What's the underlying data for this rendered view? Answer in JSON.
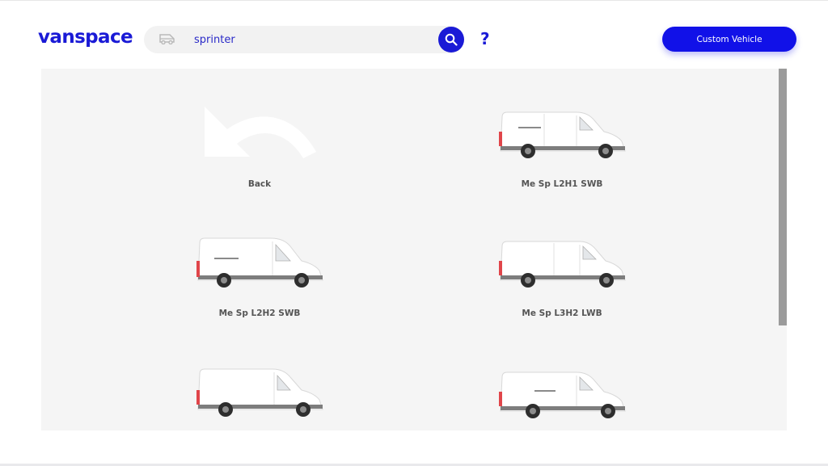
{
  "header": {
    "logo": "vanspace",
    "search_value": "sprinter",
    "help_label": "?",
    "custom_button_label": "Custom Vehicle"
  },
  "colors": {
    "brand": "#1a1ad6",
    "button": "#1111e8",
    "panel": "#f5f5f5"
  },
  "tiles": [
    {
      "label": "Back",
      "icon": "back-arrow-icon"
    },
    {
      "label": "Me Sp L2H1 SWB",
      "icon": "van-icon"
    },
    {
      "label": "Me Sp L2H2 SWB",
      "icon": "van-icon"
    },
    {
      "label": "Me Sp L3H2 LWB",
      "icon": "van-icon"
    },
    {
      "label": "",
      "icon": "van-icon"
    },
    {
      "label": "",
      "icon": "van-icon"
    }
  ]
}
